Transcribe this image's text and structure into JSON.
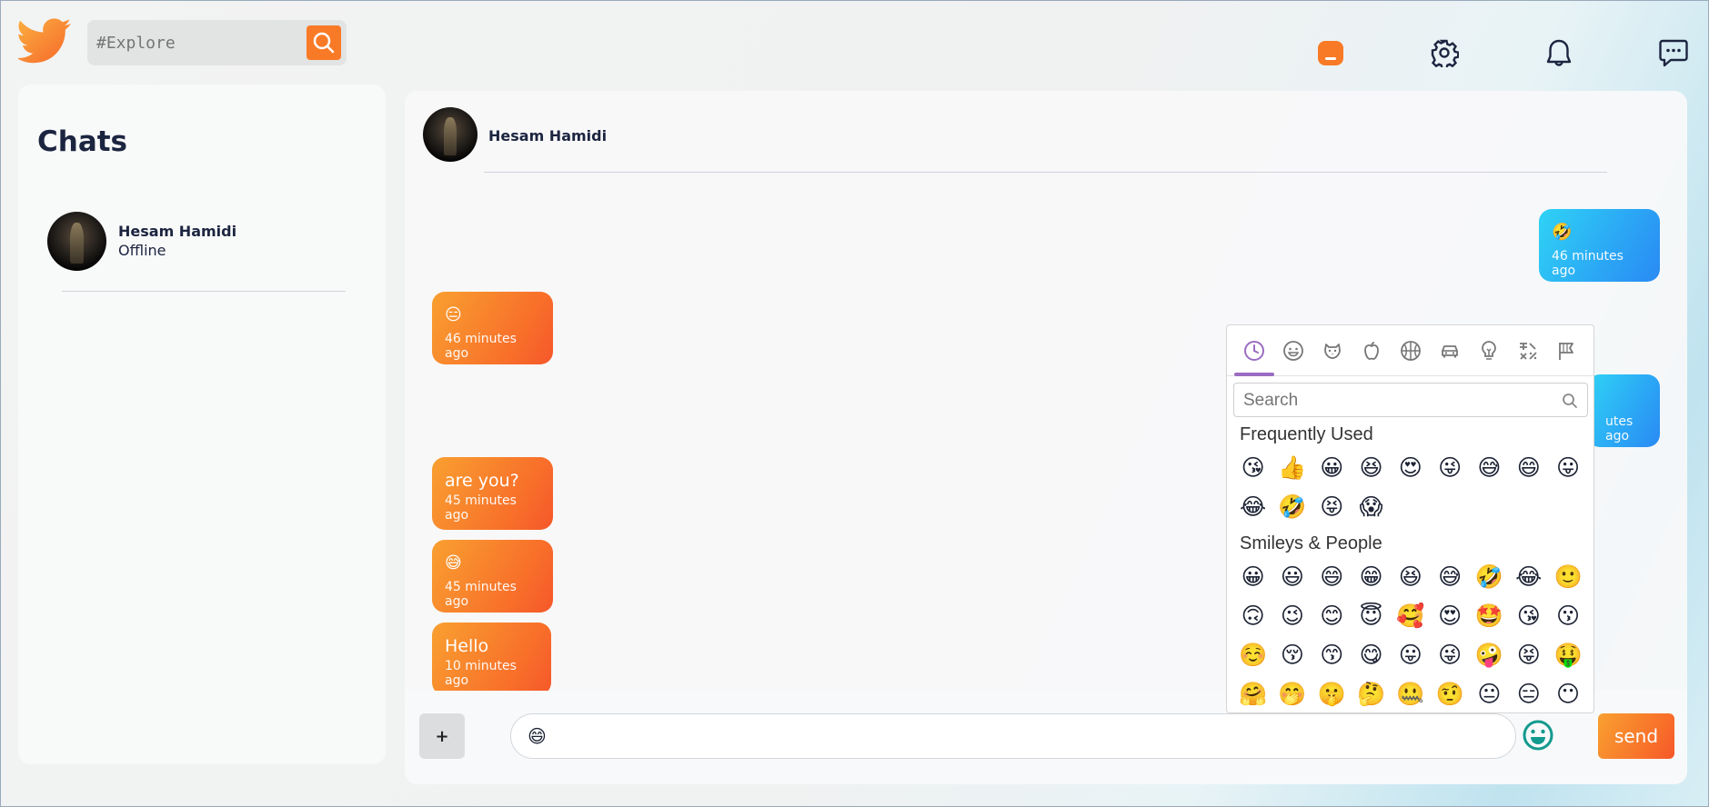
{
  "topbar": {
    "search_placeholder": "#Explore",
    "icons": [
      "twitter-logo",
      "search-icon",
      "home-icon",
      "gear-icon",
      "bell-icon",
      "chat-icon"
    ],
    "accent": "#f97a26"
  },
  "sidebar": {
    "title": "Chats",
    "contacts": [
      {
        "name": "Hesam Hamidi",
        "status": "Offline"
      }
    ]
  },
  "chat": {
    "header_name": "Hesam Hamidi",
    "messages": [
      {
        "dir": "out",
        "text": "🤣",
        "time": "46 minutes ago"
      },
      {
        "dir": "in",
        "text": "😑",
        "time": "46 minutes ago"
      },
      {
        "dir": "out",
        "text": "",
        "time": "utes ago"
      },
      {
        "dir": "in",
        "text": "are you?",
        "time": "45 minutes ago"
      },
      {
        "dir": "in",
        "text": "😅",
        "time": "45 minutes ago"
      },
      {
        "dir": "in",
        "text": "Hello",
        "time": "10 minutes ago"
      }
    ],
    "input_value": "😄",
    "attach_label": "+",
    "send_label": "send"
  },
  "emoji_picker": {
    "tab_icons": [
      "clock-icon",
      "smiley-icon",
      "animal-icon",
      "food-icon",
      "sports-icon",
      "travel-icon",
      "objects-icon",
      "symbols-icon",
      "flags-icon"
    ],
    "search_placeholder": "Search",
    "sections": [
      {
        "title": "Frequently Used",
        "emojis": [
          "😘",
          "👍",
          "😀",
          "😆",
          "😍",
          "😜",
          "😅",
          "😄",
          "😛",
          "😂",
          "🤣",
          "😝",
          "😱"
        ]
      },
      {
        "title": "Smileys & People",
        "emojis": [
          "😀",
          "😃",
          "😄",
          "😁",
          "😆",
          "😅",
          "🤣",
          "😂",
          "🙂",
          "🙃",
          "😉",
          "😊",
          "😇",
          "🥰",
          "😍",
          "🤩",
          "😘",
          "😗",
          "☺️",
          "😚",
          "😙",
          "😋",
          "😛",
          "😜",
          "🤪",
          "😝",
          "🤑",
          "🤗",
          "🤭",
          "🤫",
          "🤔",
          "🤐",
          "🤨",
          "😐",
          "😑",
          "😶"
        ]
      }
    ]
  }
}
